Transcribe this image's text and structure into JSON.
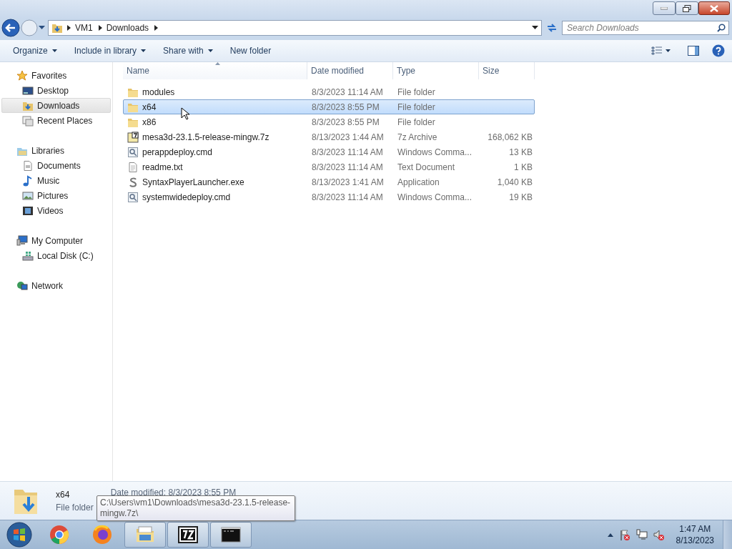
{
  "address": {
    "breadcrumbs": [
      "VM1",
      "Downloads"
    ]
  },
  "search": {
    "placeholder": "Search Downloads"
  },
  "toolbar": {
    "buttons": [
      {
        "label": "Organize",
        "dropdown": true
      },
      {
        "label": "Include in library",
        "dropdown": true
      },
      {
        "label": "Share with",
        "dropdown": true
      },
      {
        "label": "New folder",
        "dropdown": false
      }
    ]
  },
  "sidebar": {
    "groups": [
      {
        "label": "Favorites",
        "kind": "star",
        "children": [
          {
            "label": "Desktop",
            "kind": "desktop",
            "selected": false
          },
          {
            "label": "Downloads",
            "kind": "downloads",
            "selected": true
          },
          {
            "label": "Recent Places",
            "kind": "recent",
            "selected": false
          }
        ]
      },
      {
        "label": "Libraries",
        "kind": "library",
        "children": [
          {
            "label": "Documents",
            "kind": "document",
            "selected": false
          },
          {
            "label": "Music",
            "kind": "music",
            "selected": false
          },
          {
            "label": "Pictures",
            "kind": "pictures",
            "selected": false
          },
          {
            "label": "Videos",
            "kind": "videos",
            "selected": false
          }
        ]
      },
      {
        "label": "My Computer",
        "kind": "computer",
        "children": [
          {
            "label": "Local Disk (C:)",
            "kind": "disk",
            "selected": false
          }
        ]
      },
      {
        "label": "Network",
        "kind": "network"
      }
    ]
  },
  "table": {
    "columns": [
      {
        "label": "Name",
        "sorted": true
      },
      {
        "label": "Date modified",
        "sorted": false
      },
      {
        "label": "Type",
        "sorted": false
      },
      {
        "label": "Size",
        "sorted": false
      }
    ],
    "rows": [
      {
        "name": "modules",
        "date": "8/3/2023 11:14 AM",
        "type": "File folder",
        "kind": "folder",
        "selected": false
      },
      {
        "name": "x64",
        "date": "8/3/2023 8:55 PM",
        "type": "File folder",
        "kind": "folder",
        "selected": true
      },
      {
        "name": "x86",
        "date": "8/3/2023 8:55 PM",
        "type": "File folder",
        "kind": "folder",
        "selected": false
      },
      {
        "name": "mesa3d-23.1.5-release-mingw.7z",
        "date": "8/13/2023 1:44 AM",
        "type": "7z Archive",
        "size": "168,062 KB",
        "kind": "archive",
        "selected": false
      },
      {
        "name": "perappdeploy.cmd",
        "date": "8/3/2023 11:14 AM",
        "type": "Windows Comma...",
        "size": "13 KB",
        "kind": "script",
        "selected": false
      },
      {
        "name": "readme.txt",
        "date": "8/3/2023 11:14 AM",
        "type": "Text Document",
        "size": "1 KB",
        "kind": "text",
        "selected": false
      },
      {
        "name": "SyntaxPlayerLauncher.exe",
        "date": "8/13/2023 1:41 AM",
        "type": "Application",
        "size": "1,040 KB",
        "kind": "app",
        "selected": false
      },
      {
        "name": "systemwidedeploy.cmd",
        "date": "8/3/2023 11:14 AM",
        "type": "Windows Comma...",
        "size": "19 KB",
        "kind": "script",
        "selected": false
      }
    ]
  },
  "details": {
    "name": "x64",
    "type": "File folder",
    "date": "Date modified: 8/3/2023 8:55 PM"
  },
  "tooltip": {
    "text": "C:\\Users\\vm1\\Downloads\\mesa3d-23.1.5-release-mingw.7z\\"
  },
  "taskbar": {
    "apps": [
      {
        "kind": "chrome"
      },
      {
        "kind": "firefox"
      },
      {
        "kind": "explorer"
      },
      {
        "kind": "sevenzip"
      },
      {
        "kind": "console"
      }
    ],
    "clock": {
      "time": "1:47 AM",
      "date": "8/13/2023"
    }
  }
}
